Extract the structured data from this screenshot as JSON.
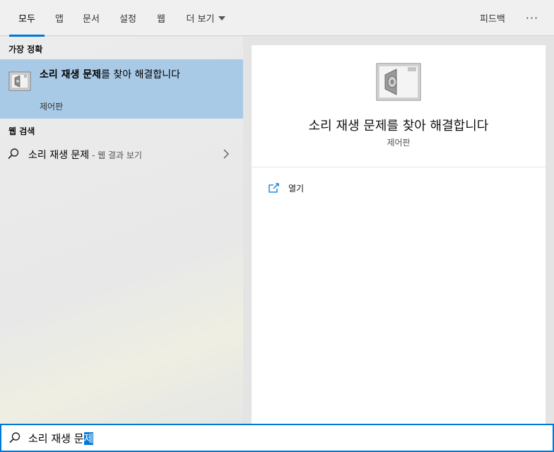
{
  "tabs": [
    {
      "label": "모두",
      "active": true
    },
    {
      "label": "앱"
    },
    {
      "label": "문서"
    },
    {
      "label": "설정"
    },
    {
      "label": "웹"
    },
    {
      "label": "더 보기"
    }
  ],
  "feedback_label": "피드백",
  "more_label": "···",
  "left": {
    "best_match_header": "가장 정확",
    "best_match": {
      "title_bold": "소리 재생 문제",
      "title_rest": "를 찾아 해결합니다",
      "subtitle": "제어판",
      "icon": "speaker-troubleshooter-icon"
    },
    "web_header": "웹 검색",
    "web_result": {
      "query": "소리 재생 문제",
      "hint": " - 웹 결과 보기",
      "icon": "search-icon"
    }
  },
  "right": {
    "title": "소리 재생 문제를 찾아 해결합니다",
    "subtitle": "제어판",
    "actions": [
      {
        "label": "열기",
        "icon": "open-icon"
      }
    ]
  },
  "search": {
    "typed": "소리 재생 문",
    "selected": "제"
  },
  "colors": {
    "accent": "#0078d7",
    "selection_bg": "#a9cae7"
  }
}
